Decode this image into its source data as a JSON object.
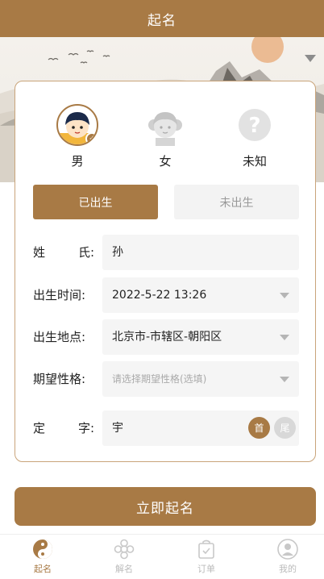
{
  "header": {
    "title": "起名"
  },
  "gender": {
    "options": [
      {
        "label": "男",
        "selected": true
      },
      {
        "label": "女",
        "selected": false
      },
      {
        "label": "未知",
        "selected": false
      }
    ]
  },
  "birth_status": {
    "born_label": "已出生",
    "unborn_label": "未出生",
    "selected": "已出生"
  },
  "form": {
    "surname": {
      "label": "姓氏:",
      "label_a": "姓",
      "label_b": "氏:",
      "value": "孙"
    },
    "birth_time": {
      "label": "出生时间:",
      "value": "2022-5-22 13:26"
    },
    "birth_place": {
      "label": "出生地点:",
      "value": "北京市-市辖区-朝阳区"
    },
    "trait": {
      "label": "期望性格:",
      "placeholder": "请选择期望性格(选填)"
    },
    "fixed_char": {
      "label": "定字:",
      "label_a": "定",
      "label_b": "字:",
      "value": "宇",
      "first_label": "首",
      "last_label": "尾",
      "selected": "首"
    }
  },
  "cta": {
    "label": "立即起名"
  },
  "tabbar": {
    "items": [
      {
        "label": "起名",
        "icon": "yin-yang-icon",
        "active": true
      },
      {
        "label": "解名",
        "icon": "flower-icon",
        "active": false
      },
      {
        "label": "订单",
        "icon": "order-bag-icon",
        "active": false
      },
      {
        "label": "我的",
        "icon": "user-icon",
        "active": false
      }
    ]
  },
  "colors": {
    "accent": "#a87a45",
    "field_bg": "#f5f5f5",
    "inactive": "#bbbbbb"
  }
}
